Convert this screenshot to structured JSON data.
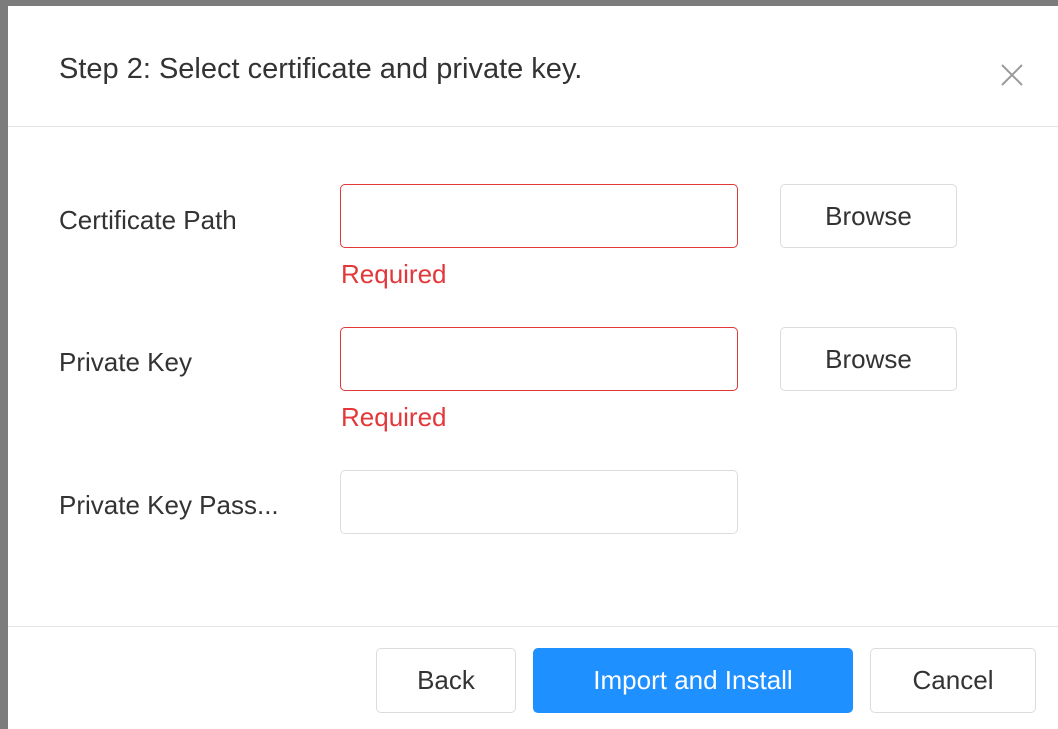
{
  "dialog": {
    "title": "Step 2: Select certificate and private key.",
    "close_icon": "close-icon"
  },
  "form": {
    "certificate_path": {
      "label": "Certificate Path",
      "value": "",
      "error": "Required",
      "browse_label": "Browse"
    },
    "private_key": {
      "label": "Private Key",
      "value": "",
      "error": "Required",
      "browse_label": "Browse"
    },
    "private_key_password": {
      "label": "Private Key Pass...",
      "value": ""
    }
  },
  "footer": {
    "back_label": "Back",
    "import_label": "Import and Install",
    "cancel_label": "Cancel"
  },
  "colors": {
    "primary": "#1e90ff",
    "error": "#e2383a",
    "border": "#dcdcdc",
    "text": "#333333"
  }
}
